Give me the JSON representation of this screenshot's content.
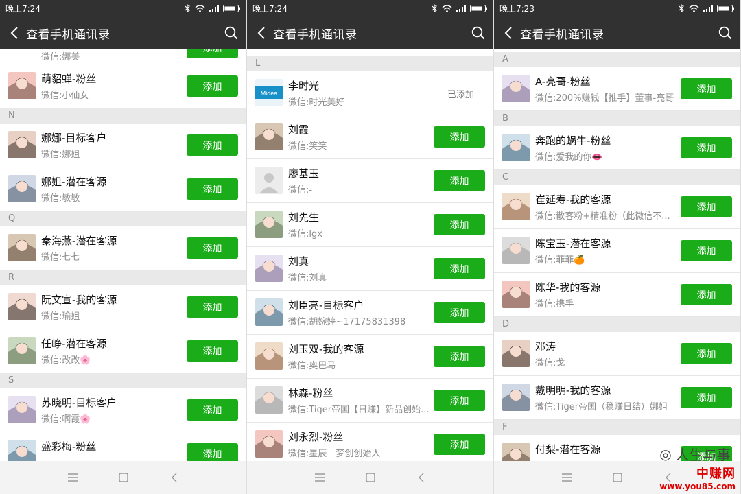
{
  "status_time": [
    "晚上7:24",
    "晚上7:24",
    "晚上7:23"
  ],
  "title": "查看手机通讯录",
  "add_label": "添加",
  "added_label": "已添加",
  "colors": {
    "bar": "#313131",
    "accent": "#1aad19",
    "section": "#e9e9e9"
  },
  "panel1": {
    "partial_top": {
      "sub": "微信:娜美"
    },
    "items": [
      {
        "type": "contact",
        "name": "萌貂蝉-粉丝",
        "sub": "微信:小仙女"
      },
      {
        "type": "section",
        "letter": "N"
      },
      {
        "type": "contact",
        "name": "娜娜-目标客户",
        "sub": "微信:娜姐"
      },
      {
        "type": "contact",
        "name": "娜姐-潜在客源",
        "sub": "微信:敏敏"
      },
      {
        "type": "section",
        "letter": "Q"
      },
      {
        "type": "contact",
        "name": "秦海燕-潜在客源",
        "sub": "微信:七七"
      },
      {
        "type": "section",
        "letter": "R"
      },
      {
        "type": "contact",
        "name": "阮文宣-我的客源",
        "sub": "微信:瑜姐"
      },
      {
        "type": "contact",
        "name": "任峥-潜在客源",
        "sub": "微信:改改🌸"
      },
      {
        "type": "section",
        "letter": "S"
      },
      {
        "type": "contact",
        "name": "苏晓明-目标客户",
        "sub": "微信:啊霞🌸"
      },
      {
        "type": "contact",
        "name": "盛彩梅-粉丝",
        "sub": ""
      }
    ]
  },
  "panel2": {
    "items": [
      {
        "type": "section",
        "letter": "L"
      },
      {
        "type": "contact",
        "name": "李时光",
        "sub": "微信:时光美好",
        "added": true,
        "avatar_text": "Midea"
      },
      {
        "type": "contact",
        "name": "刘霞",
        "sub": "微信:笑笑"
      },
      {
        "type": "contact",
        "name": "廖基玉",
        "sub": "微信:-"
      },
      {
        "type": "contact",
        "name": "刘先生",
        "sub": "微信:lgx"
      },
      {
        "type": "contact",
        "name": "刘真",
        "sub": "微信:刘真"
      },
      {
        "type": "contact",
        "name": "刘臣亮-目标客户",
        "sub": "微信:胡婉婷~17175831398"
      },
      {
        "type": "contact",
        "name": "刘玉双-我的客源",
        "sub": "微信:奥巴马"
      },
      {
        "type": "contact",
        "name": "林森-粉丝",
        "sub": "微信:Tiger帝国【日赚】新品创始..."
      },
      {
        "type": "contact",
        "name": "刘永烈-粉丝",
        "sub": "微信:星辰　梦创创始人"
      }
    ]
  },
  "panel3": {
    "items": [
      {
        "type": "section",
        "letter": "A"
      },
      {
        "type": "contact",
        "name": "A-亮哥-粉丝",
        "sub": "微信:200%赚钱【推手】董事-亮哥"
      },
      {
        "type": "section",
        "letter": "B"
      },
      {
        "type": "contact",
        "name": "奔跑的蜗牛-粉丝",
        "sub": "微信:爱我的你👄"
      },
      {
        "type": "section",
        "letter": "C"
      },
      {
        "type": "contact",
        "name": "崔延寿-我的客源",
        "sub": "微信:散客粉+精准粉（此微信不..."
      },
      {
        "type": "contact",
        "name": "陈宝玉-潜在客源",
        "sub": "微信:菲菲🍊"
      },
      {
        "type": "contact",
        "name": "陈华-我的客源",
        "sub": "微信:携手"
      },
      {
        "type": "section",
        "letter": "D"
      },
      {
        "type": "contact",
        "name": "邓涛",
        "sub": "微信:戈"
      },
      {
        "type": "contact",
        "name": "戴明明-我的客源",
        "sub": "微信:Tiger帝国（稳赚日结）娜姐"
      },
      {
        "type": "section",
        "letter": "F"
      },
      {
        "type": "contact",
        "name": "付梨-潜在客源",
        "sub": ""
      }
    ]
  },
  "watermark": {
    "text": "人生与事",
    "brand": "中赚网",
    "url": "www.you85.com"
  }
}
